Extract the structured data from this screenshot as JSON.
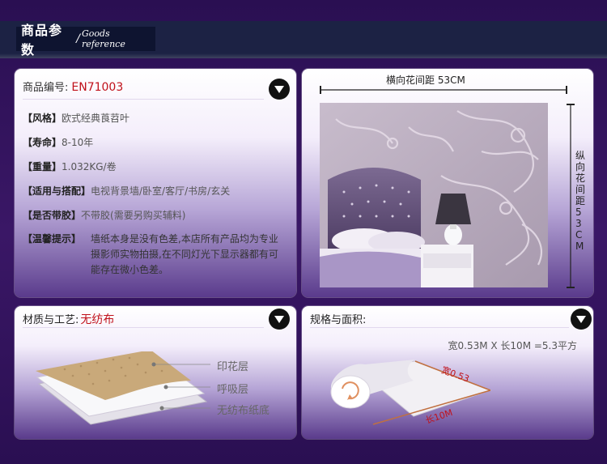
{
  "header": {
    "title_cn": "商品参数",
    "title_sep": "/",
    "title_en": "Goods reference"
  },
  "params": {
    "code_label": "商品编号:",
    "code_value": "EN71003",
    "rows": [
      {
        "label": "【风格】",
        "value": "欧式经典莨苕叶"
      },
      {
        "label": "【寿命】",
        "value": "8-10年"
      },
      {
        "label": "【重量】",
        "value": "1.032KG/卷"
      },
      {
        "label": "【适用与搭配】",
        "value": "电视背景墙/卧室/客厅/书房/玄关"
      },
      {
        "label": "【是否带胶】",
        "value": "不带胶(需要另购买辅料)"
      }
    ],
    "tip_label": "【温馨提示】",
    "tip_value": "墙纸本身是没有色差,本店所有产品均为专业摄影师实物拍摄,在不同灯光下显示器都有可能存在微小色差。"
  },
  "pattern": {
    "horizontal_label": "横向花间距 53CM",
    "vertical_label": "纵向花间距53CM"
  },
  "material": {
    "label": "材质与工艺:",
    "value": "无纺布",
    "layers": [
      "印花层",
      "呼吸层",
      "无纺布纸底"
    ]
  },
  "spec": {
    "label": "规格与面积:",
    "text": "宽0.53M X 长10M =5.3平方",
    "width_label": "宽0.53",
    "length_label": "长10M"
  },
  "icons": {
    "down": "chevron-down-icon"
  },
  "colors": {
    "accent_red": "#c0111a",
    "header_bg": "#1c2244"
  }
}
